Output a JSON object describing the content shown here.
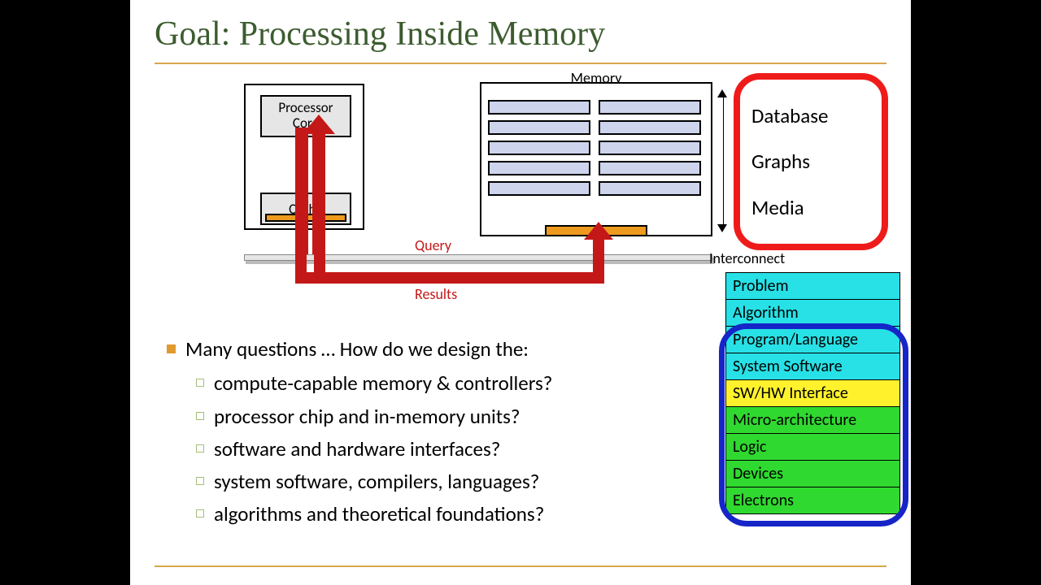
{
  "title": "Goal: Processing Inside Memory",
  "diagram": {
    "processor_core": "Processor\nCore",
    "cache": "Cache",
    "memory_label": "Memory",
    "interconnect": "Interconnect",
    "query": "Query",
    "results": "Results"
  },
  "applications": [
    "Database",
    "Graphs",
    "Media"
  ],
  "bullets": {
    "lead": "Many questions … How do we design the:",
    "items": [
      "compute-capable memory & controllers?",
      "processor chip and in-memory units?",
      "software and hardware interfaces?",
      "system software, compilers, languages?",
      "algorithms and theoretical foundations?"
    ]
  },
  "stack": [
    {
      "label": "Problem",
      "color": "cyan"
    },
    {
      "label": "Algorithm",
      "color": "cyan"
    },
    {
      "label": "Program/Language",
      "color": "cyan"
    },
    {
      "label": "System Software",
      "color": "cyan"
    },
    {
      "label": "SW/HW Interface",
      "color": "yellow"
    },
    {
      "label": "Micro-architecture",
      "color": "green"
    },
    {
      "label": "Logic",
      "color": "green"
    },
    {
      "label": "Devices",
      "color": "green"
    },
    {
      "label": "Electrons",
      "color": "green"
    }
  ]
}
